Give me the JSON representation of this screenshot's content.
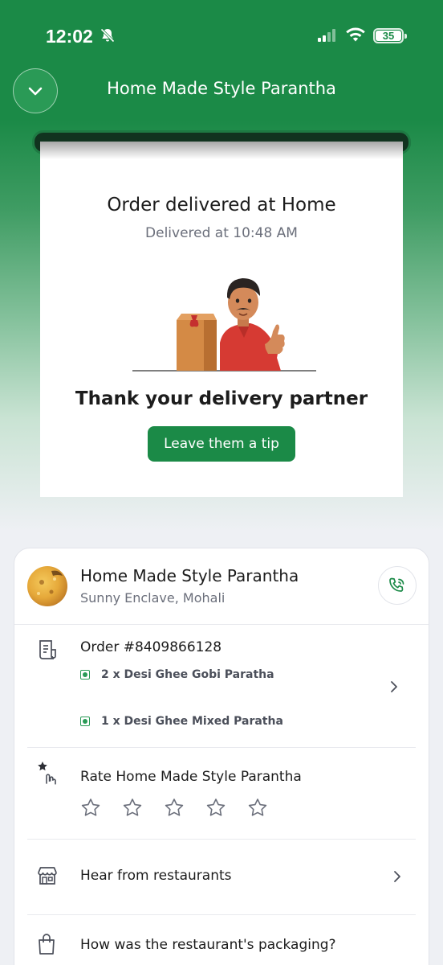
{
  "status_bar": {
    "time": "12:02",
    "battery": "35"
  },
  "header": {
    "title": "Home Made Style Parantha"
  },
  "receipt": {
    "title": "Order delivered at Home",
    "subtitle": "Delivered at 10:48 AM",
    "thank_title": "Thank your delivery partner",
    "tip_button": "Leave them a tip"
  },
  "restaurant": {
    "name": "Home Made Style Parantha",
    "location": "Sunny Enclave, Mohali"
  },
  "order": {
    "number": "Order #8409866128",
    "items": [
      {
        "label": "2 x Desi Ghee Gobi Paratha"
      },
      {
        "label": "1 x Desi Ghee Mixed Paratha"
      }
    ]
  },
  "rating": {
    "label": "Rate Home Made Style Parantha",
    "stars": 0,
    "max_stars": 5
  },
  "menu_rows": {
    "hear_from_restaurants": "Hear from restaurants",
    "packaging": "How was the restaurant's packaging?"
  },
  "colors": {
    "brand_green": "#1b8a47",
    "veg_green": "#2a9a56"
  }
}
